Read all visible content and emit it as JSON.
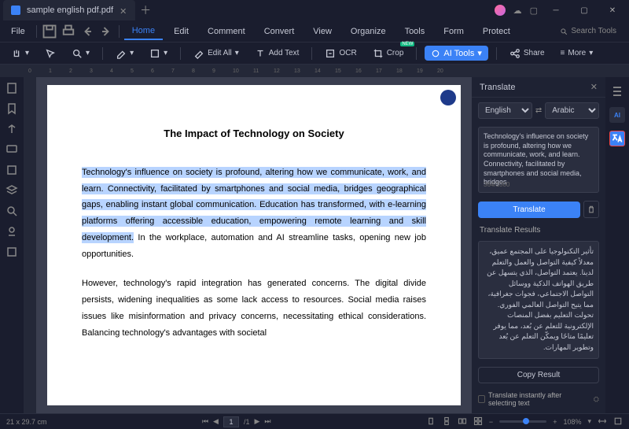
{
  "titlebar": {
    "tab_title": "sample english pdf.pdf"
  },
  "menu": {
    "file": "File",
    "tabs": [
      "Home",
      "Edit",
      "Comment",
      "Convert",
      "View",
      "Organize",
      "Tools",
      "Form",
      "Protect"
    ],
    "active_tab": "Home",
    "search_placeholder": "Search Tools"
  },
  "toolbar": {
    "edit_all": "Edit All",
    "add_text": "Add Text",
    "ocr": "OCR",
    "crop": "Crop",
    "ai_tools": "AI Tools",
    "share": "Share",
    "more": "More"
  },
  "document": {
    "title": "The Impact of Technology on Society",
    "p1_highlighted": "Technology's influence on society is profound, altering how we communicate, work, and learn. Connectivity, facilitated by smartphones and social media, bridges geographical gaps, enabling instant global communication. Education has transformed, with e-learning platforms offering accessible education, empowering remote learning and skill development.",
    "p1_rest": " In the workplace, automation and AI streamline tasks, opening new job opportunities.",
    "p2": "However, technology's rapid integration has generated concerns. The digital divide persists, widening inequalities as some lack access to resources. Social media raises issues like misinformation and privacy concerns, necessitating ethical considerations. Balancing technology's advantages with societal"
  },
  "translate": {
    "panel_title": "Translate",
    "lang_from": "English",
    "lang_to": "Arabic",
    "source_text": "Technology's influence on society is profound, altering how we communicate, work, and learn. Connectivity, facilitated by smartphones and social media, bridges",
    "char_count": "364/1000",
    "translate_btn": "Translate",
    "results_label": "Translate Results",
    "result_text": "تأثير التكنولوجيا على المجتمع عميق، معدلاً كيفية التواصل والعمل والتعلم لدينا. يعتمد التواصل، الذي يتسهل عن طريق الهواتف الذكية ووسائل التواصل الاجتماعي، فجوات جغرافية، مما يتيح التواصل العالمي الفوري. تحولت التعليم بفضل المنصات الإلكترونية للتعلم عن بُعد، مما يوفر تعليمًا متاحًا ويمكّن التعلم عن بُعد وتطوير المهارات.",
    "copy_btn": "Copy Result",
    "instant_label": "Translate instantly after selecting text"
  },
  "status": {
    "dimensions": "21 x 29.7 cm",
    "page_current": "1",
    "page_total": "/1",
    "zoom": "108%"
  },
  "ruler_marks": [
    "0",
    "1",
    "2",
    "3",
    "4",
    "5",
    "6",
    "7",
    "8",
    "9",
    "10",
    "11",
    "12",
    "13",
    "14",
    "15",
    "16",
    "17",
    "18",
    "19",
    "20"
  ]
}
